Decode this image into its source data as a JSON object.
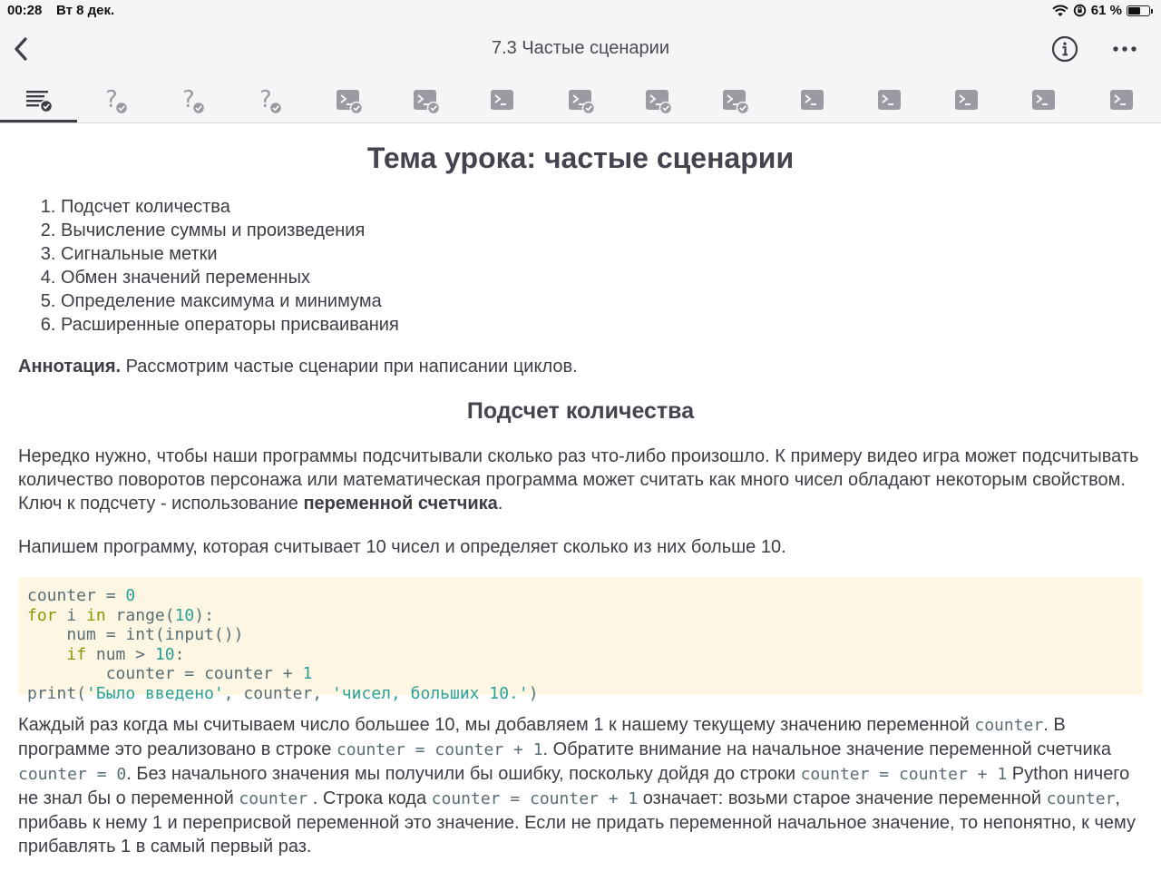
{
  "status_bar": {
    "time": "00:28",
    "date": "Вт 8 дек.",
    "battery_text": "61 %",
    "battery_level": 0.61
  },
  "nav": {
    "title": "7.3 Частые сценарии",
    "back_icon": "chevron-left-icon",
    "info_icon": "info-icon",
    "more_icon": "more-dots-icon"
  },
  "tabs": [
    {
      "type": "theory",
      "icon": "list-checked-icon",
      "completed": true,
      "active": true
    },
    {
      "type": "quiz",
      "icon": "question-icon",
      "completed": true
    },
    {
      "type": "quiz",
      "icon": "question-icon",
      "completed": true
    },
    {
      "type": "quiz",
      "icon": "question-icon",
      "completed": true
    },
    {
      "type": "code",
      "icon": "terminal-icon",
      "completed": true
    },
    {
      "type": "code",
      "icon": "terminal-icon",
      "completed": true
    },
    {
      "type": "code",
      "icon": "terminal-icon",
      "completed": false
    },
    {
      "type": "code",
      "icon": "terminal-icon",
      "completed": true
    },
    {
      "type": "code",
      "icon": "terminal-icon",
      "completed": true
    },
    {
      "type": "code",
      "icon": "terminal-icon",
      "completed": true
    },
    {
      "type": "code",
      "icon": "terminal-icon",
      "completed": false
    },
    {
      "type": "code",
      "icon": "terminal-icon",
      "completed": false
    },
    {
      "type": "code",
      "icon": "terminal-icon",
      "completed": false
    },
    {
      "type": "code",
      "icon": "terminal-icon",
      "completed": false
    },
    {
      "type": "code",
      "icon": "terminal-icon",
      "completed": false
    }
  ],
  "lesson": {
    "title": "Тема урока: частые сценарии",
    "topics": [
      "Подсчет количества",
      "Вычисление суммы и произведения",
      "Сигнальные метки",
      "Обмен значений переменных",
      "Определение максимума и минимума",
      "Расширенные операторы присваивания"
    ],
    "annotation_label": "Аннотация.",
    "annotation_text": " Рассмотрим частые сценарии при написании циклов.",
    "section_title": "Подсчет количества",
    "p1_a": "Нередко нужно, чтобы наши программы подсчитывали сколько раз что-либо произошло. К примеру видео игра может подсчитывать количество поворотов персонажа или математическая программа может считать как много чисел обладают некоторым свойством. Ключ к подсчету - использование ",
    "p1_bold": "переменной счетчика",
    "p1_end": ".",
    "p2": "Напишем программу, которая считывает 10 чисел и определяет сколько из них больше 10.",
    "code_lines": [
      [
        {
          "t": "counter = ",
          "c": "plain"
        },
        {
          "t": "0",
          "c": "num"
        }
      ],
      [
        {
          "t": "for",
          "c": "kw"
        },
        {
          "t": " i ",
          "c": "plain"
        },
        {
          "t": "in",
          "c": "kw"
        },
        {
          "t": " range(",
          "c": "plain"
        },
        {
          "t": "10",
          "c": "num"
        },
        {
          "t": "):",
          "c": "plain"
        }
      ],
      [
        {
          "t": "    num = int(input())",
          "c": "plain"
        }
      ],
      [
        {
          "t": "    ",
          "c": "plain"
        },
        {
          "t": "if",
          "c": "kw"
        },
        {
          "t": " num > ",
          "c": "plain"
        },
        {
          "t": "10",
          "c": "num"
        },
        {
          "t": ":",
          "c": "plain"
        }
      ],
      [
        {
          "t": "        counter = counter + ",
          "c": "plain"
        },
        {
          "t": "1",
          "c": "num"
        }
      ],
      [
        {
          "t": "print(",
          "c": "plain"
        },
        {
          "t": "'Было введено'",
          "c": "str"
        },
        {
          "t": ", counter, ",
          "c": "plain"
        },
        {
          "t": "'чисел, больших 10.'",
          "c": "str"
        },
        {
          "t": ")",
          "c": "plain"
        }
      ]
    ],
    "p3_parts": [
      {
        "t": "Каждый раз когда мы считываем число большее 10, мы добавляем 1 к нашему текущему значению переменной ",
        "code": false
      },
      {
        "t": "counter",
        "code": true
      },
      {
        "t": ". В программе это реализовано в строке ",
        "code": false
      },
      {
        "t": "counter = counter + 1",
        "code": true
      },
      {
        "t": ". Обратите внимание на начальное значение переменной счетчика ",
        "code": false
      },
      {
        "t": "counter = 0",
        "code": true
      },
      {
        "t": ". Без начального значения мы получили бы ошибку, поскольку дойдя до строки ",
        "code": false
      },
      {
        "t": "counter = counter + 1",
        "code": true
      },
      {
        "t": " Python ничего не знал бы о переменной ",
        "code": false
      },
      {
        "t": "counter",
        "code": true
      },
      {
        "t": " . Строка кода ",
        "code": false
      },
      {
        "t": "counter = counter + 1",
        "code": true
      },
      {
        "t": " означает: возьми старое значение переменной ",
        "code": false
      },
      {
        "t": "counter",
        "code": true
      },
      {
        "t": ", прибавь к нему 1 и переприсвой переменной это значение. Если не придать переменной начальное значение, то непонятно, к чему прибавлять 1 в самый первый раз.",
        "code": false
      }
    ]
  }
}
